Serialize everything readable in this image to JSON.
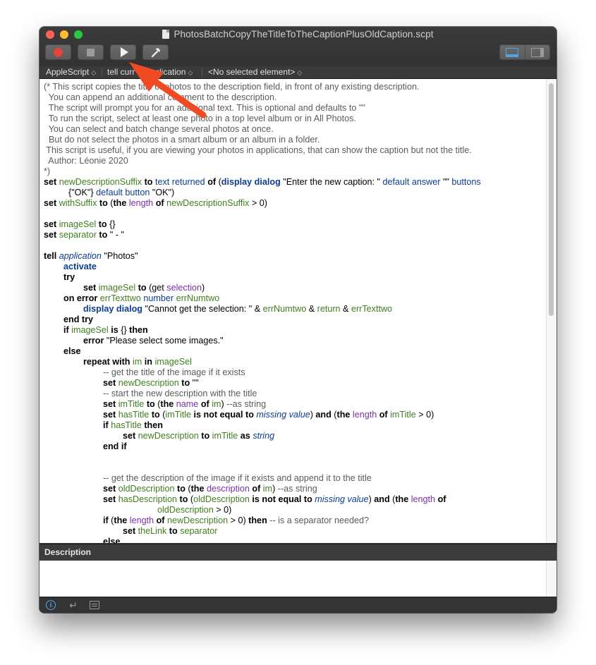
{
  "window": {
    "title": "PhotosBatchCopyTheTitleToTheCaptionPlusOldCaption.scpt"
  },
  "toolbar": {
    "record_icon": "record-icon",
    "stop_icon": "stop-icon",
    "run_icon": "play-icon",
    "compile_icon": "hammer-icon"
  },
  "navbar": {
    "language": "AppleScript",
    "target_prefix": "tell curr",
    "target_suffix": "plication",
    "element": "<No selected element>"
  },
  "code": {
    "l01": "(* This script copies the title of photos to the description field, in front of any existing description.",
    "l02": "  You can append an additional comment to the description.",
    "l03": "  The script will prompt you for an additional text. This is optional and defaults to \"\"",
    "l04": "  To run the script, select at least one photo in a top level album or in All Photos.",
    "l05": "  You can select and batch change several photos at once.",
    "l06": "  But do not select the photos in a smart album or an album in a folder.",
    "l07": " This script is useful, if you are viewing your photos in applications, that can show the caption but not the title.",
    "l08": "  Author: Léonie 2020",
    "l09": "*)",
    "set": "set",
    "to": "to",
    "of": "of",
    "if": "if",
    "then": "then",
    "tell": "tell",
    "try": "try",
    "else": "else",
    "end_if": "end if",
    "end_try": "end try",
    "repeat_with": "repeat with",
    "in": "in",
    "is": "is",
    "as": "as",
    "and": "and",
    "error": "error",
    "on_error": "on error",
    "activate": "activate",
    "display_dialog": "display dialog",
    "text_returned": "text returned",
    "default_answer": "default answer",
    "buttons": "buttons",
    "default_button": "default button",
    "length": "length",
    "name": "name",
    "description": "description",
    "selection": "selection",
    "get": "get",
    "number": "number",
    "return": "return",
    "application": "application",
    "is_not_equal_to": "is not equal to",
    "missing_value": "missing value",
    "string": "string",
    "newDescriptionSuffix": "newDescriptionSuffix",
    "withSuffix": "withSuffix",
    "imageSel": "imageSel",
    "separator": "separator",
    "errTexttwo": "errTexttwo",
    "errNumtwo": "errNumtwo",
    "im": "im",
    "newDescription": "newDescription",
    "imTitle": "imTitle",
    "hasTitle": "hasTitle",
    "oldDescription": "oldDescription",
    "hasDescription": "hasDescription",
    "theLink": "theLink",
    "s_caption": " \"Enter the new caption: \" ",
    "s_empty_answer": " \"\" ",
    "s_ok_list": "{\"OK\"} ",
    "s_ok": " \"OK\")",
    "s_gt0": " > 0)",
    "s_braces": " {}",
    "s_sep": " \" - \"",
    "s_photos": " \"Photos\"",
    "s_get_sel": " (get ",
    "s_cannot": " \"Cannot get the selection: \" & ",
    "s_amp": " & ",
    "s_please": " \"Please select some images.\"",
    "c_title": "-- get the title of the image if it exists",
    "s_emptystr": " \"\"",
    "c_start": "-- start the new description with the title",
    "c_asstring": " --as string",
    "c_getdesc": "-- get the description of the image if it exists and append it to the title",
    "c_sepneeded": " -- is a separator needed?"
  },
  "description_panel": {
    "header": "Description"
  },
  "bottombar": {
    "info_icon": "info-icon",
    "return_icon": "return-icon",
    "list_icon": "list-icon"
  },
  "colors": {
    "accent": "#4fa3e8",
    "annotation_arrow": "#f04a23"
  }
}
